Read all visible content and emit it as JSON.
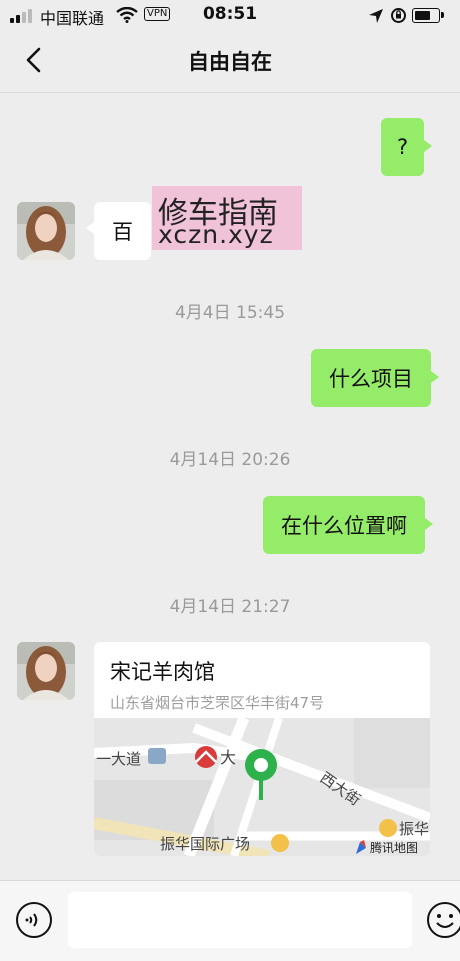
{
  "status_bar": {
    "carrier": "中国联通",
    "vpn": "VPN",
    "time": "08:51",
    "battery_level": 0.8
  },
  "nav": {
    "title": "自由自在"
  },
  "messages": [
    {
      "side": "right",
      "text": "?"
    },
    {
      "side": "left",
      "text": "百"
    },
    {
      "timestamp": "4月4日 15:45"
    },
    {
      "side": "right",
      "text": "什么项目"
    },
    {
      "timestamp": "4月14日 20:26"
    },
    {
      "side": "right",
      "text": "在什么位置啊"
    },
    {
      "timestamp": "4月14日 21:27"
    }
  ],
  "watermark": {
    "line1": "修车指南",
    "line2": "xczn.xyz"
  },
  "location_card": {
    "name": "宋记羊肉馆",
    "address": "山东省烟台市芝罘区华丰街47号",
    "map_labels": {
      "road1": "一大道",
      "poi1": "大",
      "road2": "西大街",
      "plaza": "振华国际广场",
      "poi2": "振华",
      "provider": "腾讯地图"
    }
  },
  "colors": {
    "my_bubble": "#95ec69",
    "their_bubble": "#ffffff",
    "background": "#ededed"
  }
}
